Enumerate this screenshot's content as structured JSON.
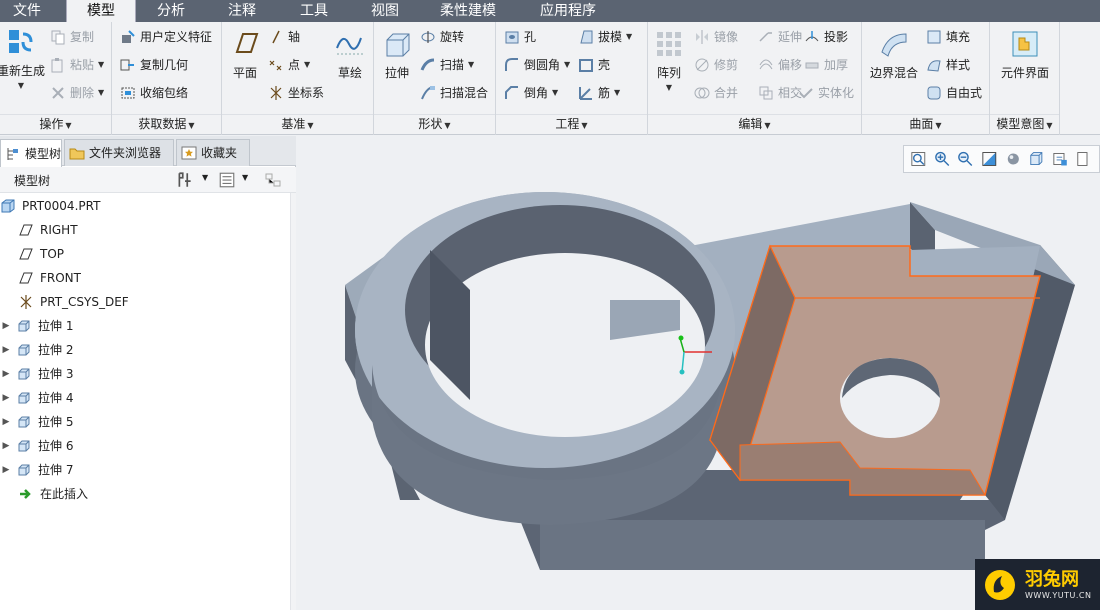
{
  "menu_tabs": [
    "文件",
    "模型",
    "分析",
    "注释",
    "工具",
    "视图",
    "柔性建模",
    "应用程序"
  ],
  "active_tab": "模型",
  "ribbon": {
    "operations": {
      "label": "操作",
      "regenerate": "重新生成",
      "copy": "复制",
      "paste": "粘贴",
      "delete": "删除"
    },
    "get_data": {
      "label": "获取数据",
      "udf": "用户定义特征",
      "copy_geom": "复制几何",
      "shrinkwrap": "收缩包络"
    },
    "datum": {
      "label": "基准",
      "plane": "平面",
      "axis": "轴",
      "point": "点",
      "csys": "坐标系",
      "sketch": "草绘"
    },
    "shapes": {
      "label": "形状",
      "extrude": "拉伸",
      "revolve": "旋转",
      "sweep": "扫描",
      "swept_blend": "扫描混合"
    },
    "engineering": {
      "label": "工程",
      "hole": "孔",
      "draft": "拔模",
      "round": "倒圆角",
      "shell": "壳",
      "chamfer": "倒角",
      "rib": "筋"
    },
    "editing": {
      "label": "编辑",
      "pattern": "阵列",
      "mirror": "镜像",
      "extend": "延伸",
      "project": "投影",
      "trim": "修剪",
      "offset": "偏移",
      "thicken": "加厚",
      "merge": "合并",
      "intersect": "相交",
      "solidify": "实体化"
    },
    "surfaces": {
      "label": "曲面",
      "boundary_blend": "边界混合",
      "fill": "填充",
      "style": "样式",
      "freestyle": "自由式"
    },
    "model_intent": {
      "label": "模型意图",
      "component_interface": "元件界面"
    }
  },
  "panel_tabs": [
    "模型树",
    "文件夹浏览器",
    "收藏夹"
  ],
  "tree_header": "模型树",
  "tree": {
    "root": "PRT0004.PRT",
    "datums": [
      "RIGHT",
      "TOP",
      "FRONT",
      "PRT_CSYS_DEF"
    ],
    "features": [
      "拉伸 1",
      "拉伸 2",
      "拉伸 3",
      "拉伸 4",
      "拉伸 5",
      "拉伸 6",
      "拉伸 7"
    ],
    "insert_here": "在此插入"
  },
  "watermark": {
    "brand": "羽兔网",
    "url": "WWW.YUTU.CN"
  },
  "colors": {
    "menubar": "#5b6472",
    "ribbon": "#f1f2f4",
    "model_body": "#a9b5c4",
    "model_dark": "#4f5866",
    "highlight_fill": "#b79a8c",
    "highlight_edge": "#ff6a1a",
    "watermark_accent": "#ffcc00"
  }
}
